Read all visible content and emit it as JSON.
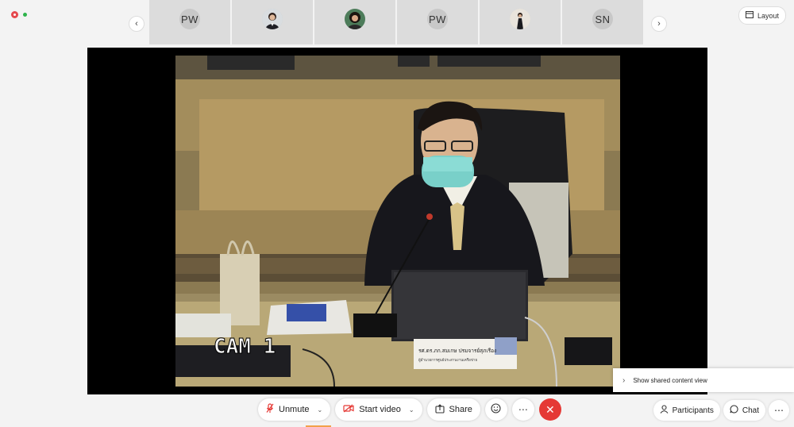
{
  "participants_strip": {
    "tiles": [
      {
        "initials": "PW"
      },
      {
        "initials": ""
      },
      {
        "initials": ""
      },
      {
        "initials": "PW"
      },
      {
        "initials": ""
      },
      {
        "initials": "SN"
      }
    ]
  },
  "header": {
    "layout_label": "Layout"
  },
  "video": {
    "cam_label": "CAM 1",
    "nameplate_line1": "รศ.ดร.ภก.สมเกษ ปรมจารย์สุภเรือง",
    "nameplate_line2": "ผู้อำนวยการศูนย์ประสานงานเครือข่าย"
  },
  "popup": {
    "show_shared_label": "Show shared content view"
  },
  "toolbar": {
    "unmute_label": "Unmute",
    "start_video_label": "Start video",
    "share_label": "Share",
    "participants_label": "Participants",
    "chat_label": "Chat"
  },
  "icons": [
    "record-dot",
    "chevron-left-icon",
    "chevron-right-icon",
    "layout-icon",
    "mic-muted-icon",
    "video-off-icon",
    "share-icon",
    "emoji-icon",
    "more-icon",
    "end-call-icon",
    "participants-icon",
    "chat-icon"
  ],
  "colors": {
    "end_call": "#e53935",
    "mute_icon": "#e53935",
    "record": "#e5484d",
    "connected": "#2db34a"
  }
}
